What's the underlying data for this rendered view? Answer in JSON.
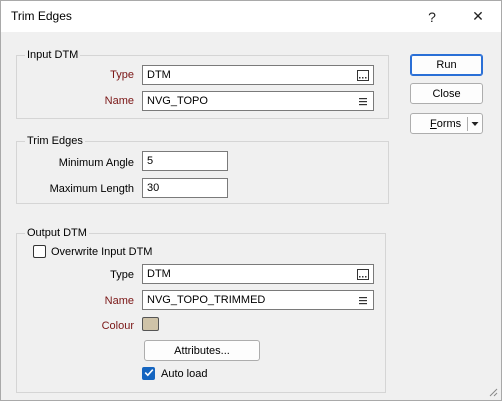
{
  "window": {
    "title": "Trim Edges",
    "help_label": "?",
    "close_label": "✕"
  },
  "input_dtm": {
    "group_label": "Input DTM",
    "type_label": "Type",
    "type_value": "DTM",
    "name_label": "Name",
    "name_value": "NVG_TOPO"
  },
  "trim_edges": {
    "group_label": "Trim Edges",
    "min_angle_label": "Minimum Angle",
    "min_angle_value": "5",
    "max_length_label": "Maximum Length",
    "max_length_value": "30"
  },
  "output_dtm": {
    "group_label": "Output DTM",
    "overwrite_label": "Overwrite Input DTM",
    "overwrite_checked": false,
    "type_label": "Type",
    "type_value": "DTM",
    "name_label": "Name",
    "name_value": "NVG_TOPO_TRIMMED",
    "colour_label": "Colour",
    "colour_value": "#cfc3a8",
    "attributes_label": "Attributes...",
    "autoload_label": "Auto load",
    "autoload_checked": true
  },
  "buttons": {
    "run": "Run",
    "close": "Close",
    "forms": "Forms"
  },
  "icons": {
    "browse": "browse-icon",
    "list": "list-icon",
    "dropdown": "chevron-down-icon",
    "check": "check-icon",
    "grip": "resize-grip-icon"
  }
}
